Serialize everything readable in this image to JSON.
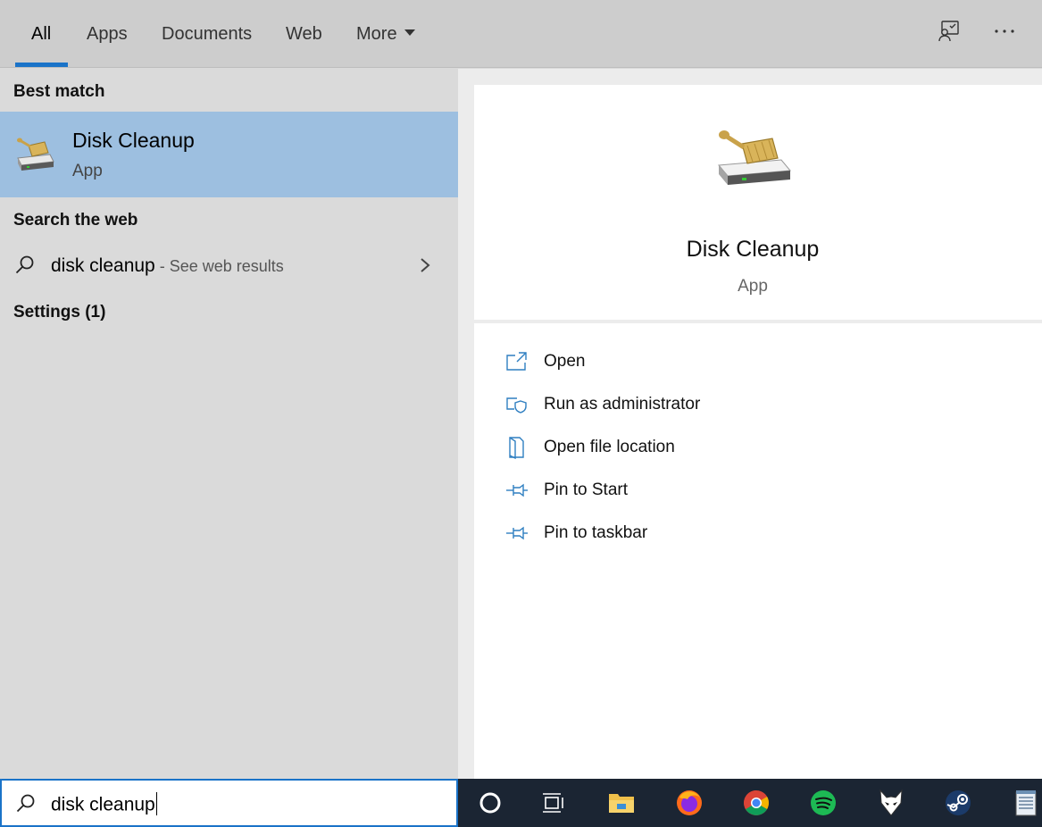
{
  "tabs": [
    {
      "label": "All",
      "active": true
    },
    {
      "label": "Apps"
    },
    {
      "label": "Documents"
    },
    {
      "label": "Web"
    },
    {
      "label": "More"
    }
  ],
  "top_icons": [
    "feedback-icon",
    "more-options-icon"
  ],
  "left": {
    "best_match_label": "Best match",
    "best_match": {
      "title": "Disk Cleanup",
      "subtitle": "App",
      "icon": "disk-cleanup-icon"
    },
    "search_web_label": "Search the web",
    "web_result": {
      "query": "disk cleanup",
      "suffix": " - See web results"
    },
    "settings_label": "Settings (1)"
  },
  "detail": {
    "title": "Disk Cleanup",
    "subtitle": "App",
    "actions": [
      {
        "label": "Open",
        "icon": "open-icon"
      },
      {
        "label": "Run as administrator",
        "icon": "run-as-admin-icon"
      },
      {
        "label": "Open file location",
        "icon": "file-location-icon"
      },
      {
        "label": "Pin to Start",
        "icon": "pin-icon"
      },
      {
        "label": "Pin to taskbar",
        "icon": "pin-icon"
      }
    ]
  },
  "search": {
    "value": "disk cleanup"
  },
  "taskbar": [
    "cortana-icon",
    "task-view-icon",
    "file-explorer-icon",
    "firefox-icon",
    "chrome-icon",
    "spotify-icon",
    "fox-app-icon",
    "steam-icon",
    "notepad-icon"
  ],
  "colors": {
    "accent": "#1a73c8",
    "selection": "#9dbfe0",
    "taskbar": "#1b2533"
  }
}
